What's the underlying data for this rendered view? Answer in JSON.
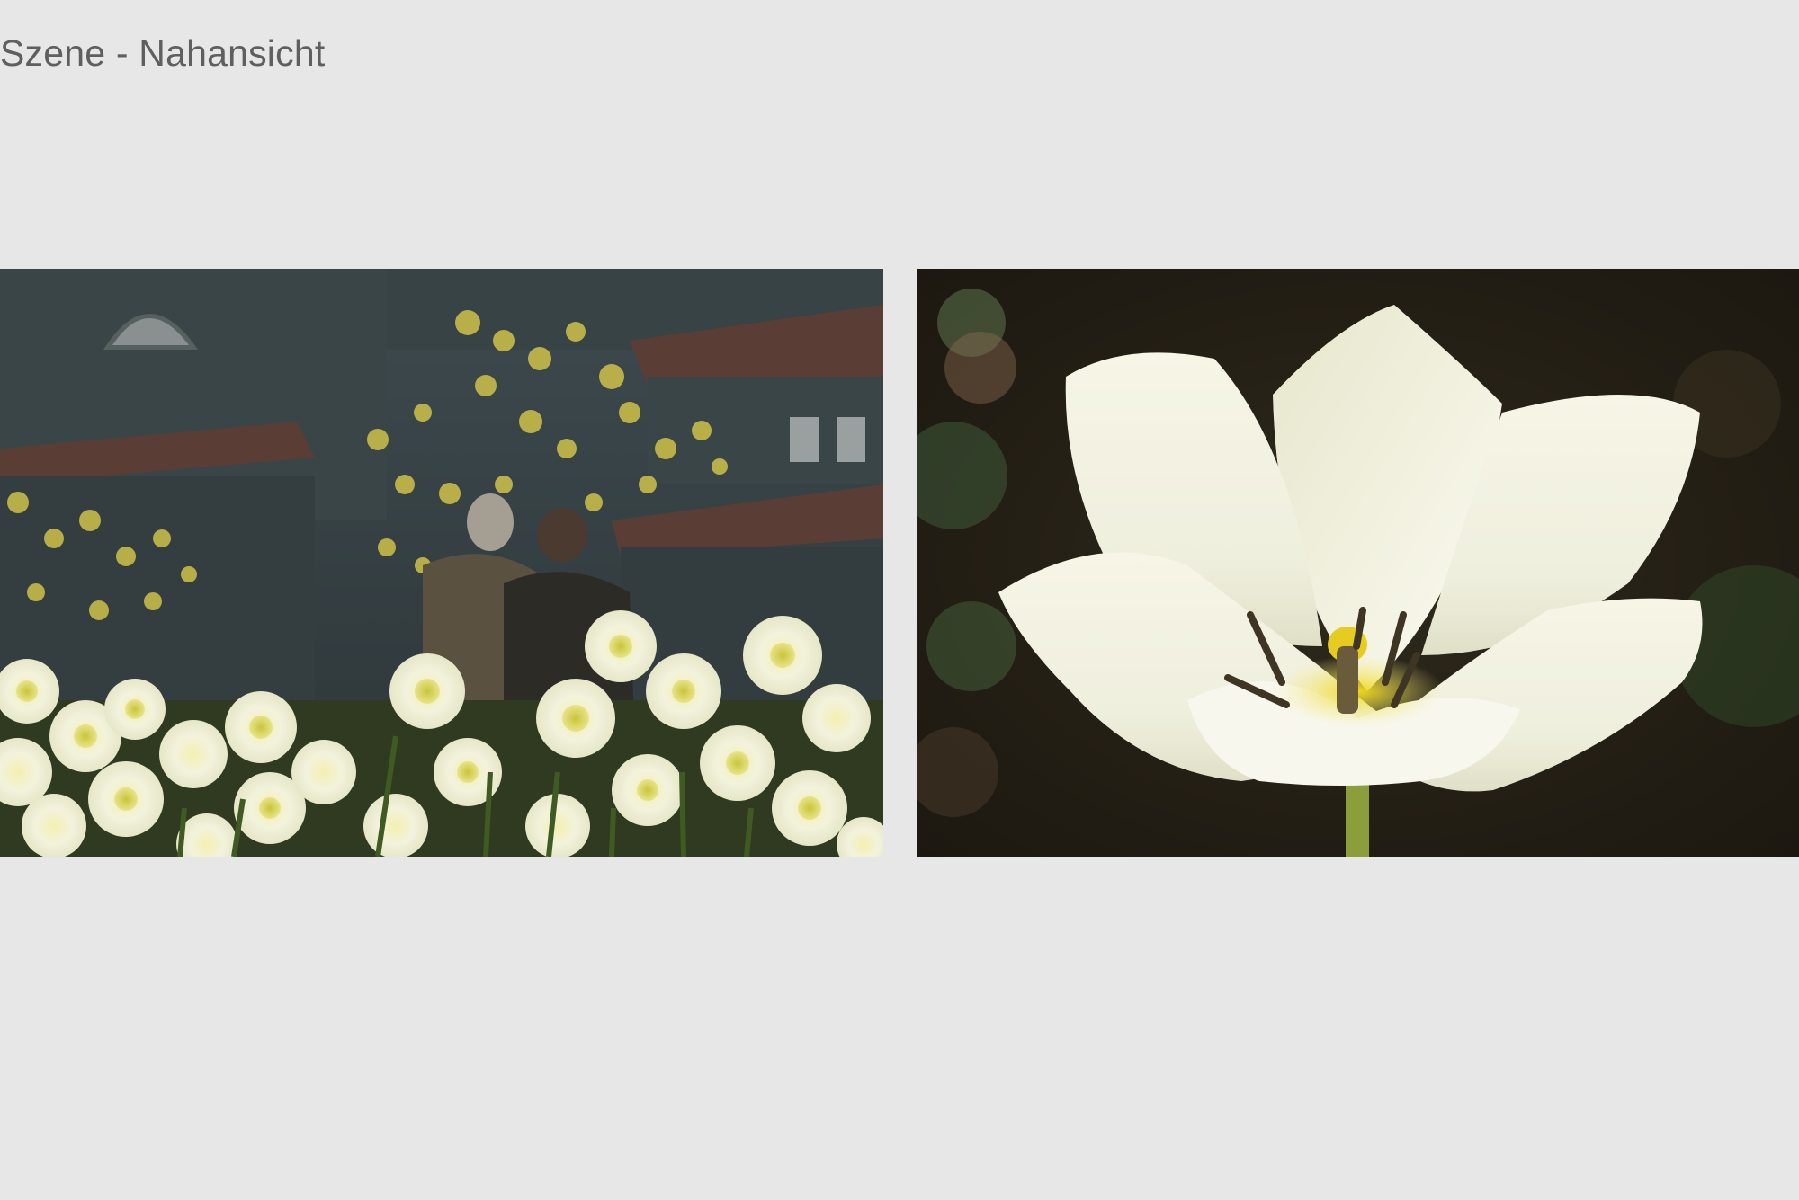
{
  "page": {
    "title": "Szene - Nahansicht"
  },
  "photos": [
    {
      "subject": "daffodils-in-front-of-building-with-couple",
      "icon": "photo-daffodils"
    },
    {
      "subject": "white-tulip-closeup",
      "icon": "photo-tulip"
    }
  ],
  "colors": {
    "background": "#e7e7e7",
    "title_text": "#5f5f5f"
  }
}
